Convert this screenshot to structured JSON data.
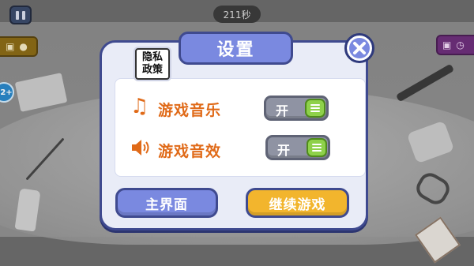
{
  "hud": {
    "timer": "211秒",
    "pause_icon": "pause-icon",
    "age_badge": "2+"
  },
  "dialog": {
    "title": "设置",
    "privacy_line1": "隐私",
    "privacy_line2": "政策",
    "rows": [
      {
        "label": "游戏音乐",
        "icon": "music-note-icon",
        "state": "开"
      },
      {
        "label": "游戏音效",
        "icon": "speaker-icon",
        "state": "开"
      }
    ],
    "main_menu_label": "主界面",
    "continue_label": "继续游戏",
    "close_icon": "close-icon"
  },
  "colors": {
    "accent": "#7a89e0",
    "border": "#3f4a8f",
    "label": "#e06a18",
    "toggle_on": "#8ed14a",
    "continue": "#f2b52d"
  }
}
